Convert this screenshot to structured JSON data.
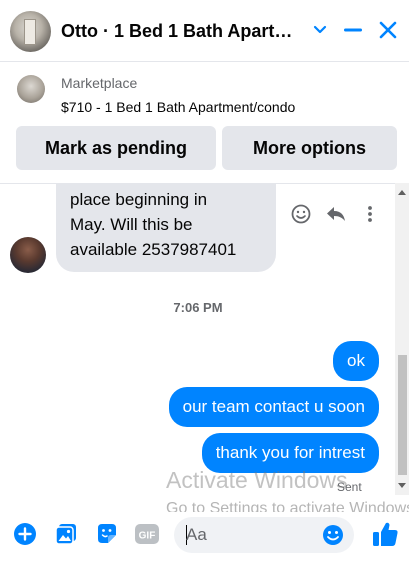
{
  "header": {
    "title": "Otto · 1 Bed 1 Bath Apartm…",
    "colors": {
      "accent": "#0084ff"
    }
  },
  "marketplace": {
    "label": "Marketplace",
    "listing_title": "$710 - 1 Bed 1 Bath Apartment/condo",
    "buttons": {
      "mark_pending": "Mark as pending",
      "more_options": "More options"
    }
  },
  "messages": {
    "incoming_lines": [
      "place beginning in",
      "May. Will this be",
      "available 2537987401"
    ],
    "timestamp": "7:06 PM",
    "outgoing": [
      "ok",
      "our team contact u soon",
      "thank you for intrest"
    ],
    "status": "Sent"
  },
  "composer": {
    "placeholder": "Aa"
  },
  "watermark": {
    "line1": "Activate Windows",
    "line2": "Go to Settings to activate Windows."
  },
  "icons": {
    "header": [
      "chevron-down-icon",
      "minimize-icon",
      "close-icon"
    ],
    "message_actions": [
      "react-smiley-icon",
      "reply-icon",
      "more-vertical-icon"
    ],
    "composer": [
      "add-icon",
      "photo-icon",
      "sticker-icon",
      "gif-icon",
      "emoji-icon",
      "thumbs-up-icon"
    ]
  }
}
